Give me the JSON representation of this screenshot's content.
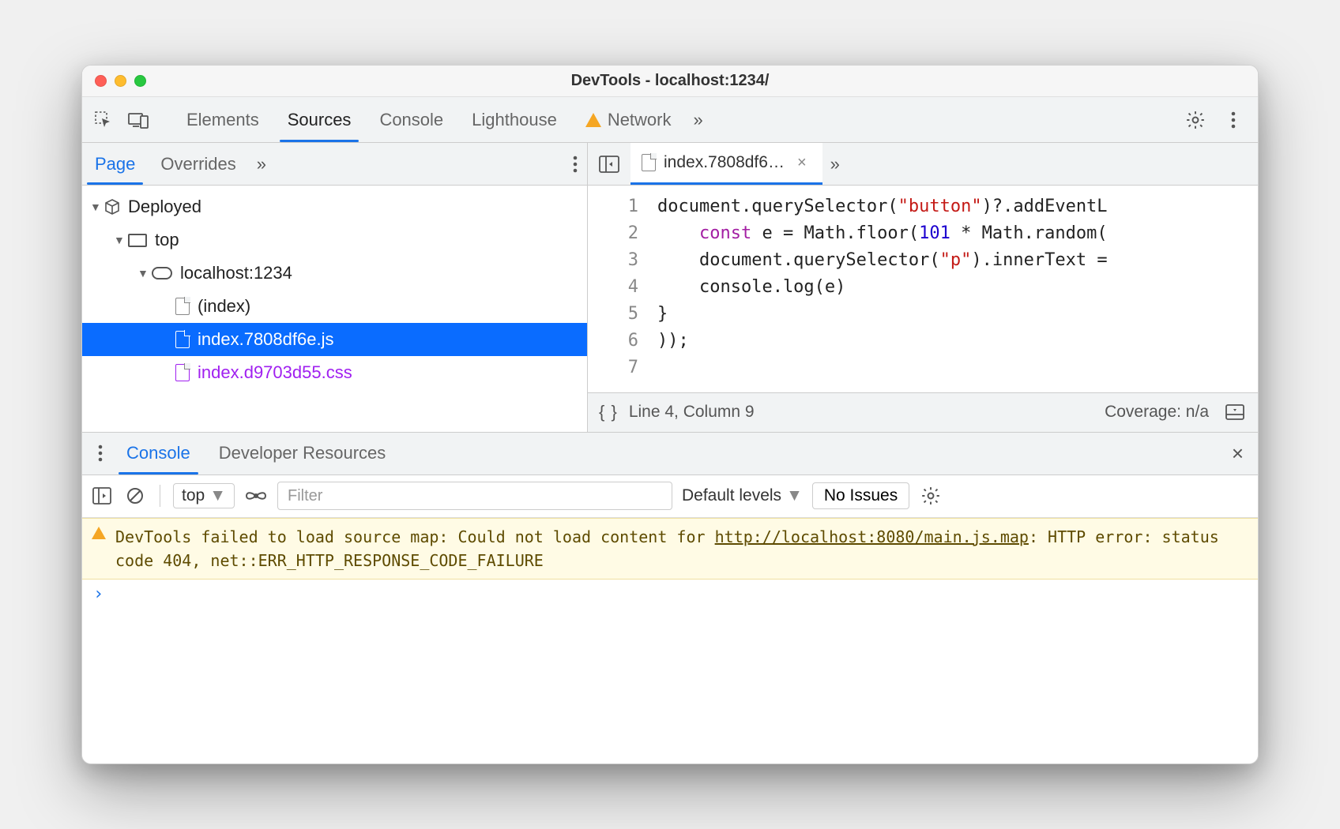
{
  "window": {
    "title": "DevTools - localhost:1234/"
  },
  "tabs": {
    "elements": "Elements",
    "sources": "Sources",
    "console": "Console",
    "lighthouse": "Lighthouse",
    "network": "Network"
  },
  "sources_subtabs": {
    "page": "Page",
    "overrides": "Overrides"
  },
  "editor_tab": {
    "filename": "index.7808df6…"
  },
  "tree": {
    "deployed": "Deployed",
    "top": "top",
    "host": "localhost:1234",
    "index": "(index)",
    "jsfile": "index.7808df6e.js",
    "cssfile": "index.d9703d55.css"
  },
  "code": {
    "l1a": "document.querySelector(",
    "l1b": "\"button\"",
    "l1c": ")?.addEventL",
    "l2a": "    ",
    "l2kw": "const",
    "l2b": " e = Math.floor(",
    "l2num": "101",
    "l2c": " * Math.random(",
    "l3a": "    document.querySelector(",
    "l3b": "\"p\"",
    "l3c": ").innerText =",
    "l4": "    console.log(e)",
    "l5": "}",
    "l6": "));",
    "l7": ""
  },
  "status": {
    "braces": "{ }",
    "pos": "Line 4, Column 9",
    "coverage": "Coverage: n/a"
  },
  "drawer": {
    "console": "Console",
    "devres": "Developer Resources"
  },
  "console_tb": {
    "context": "top",
    "filter_placeholder": "Filter",
    "levels": "Default levels",
    "issues": "No Issues"
  },
  "console_msg": {
    "pre": "DevTools failed to load source map: Could not load content for ",
    "url": "http://localhost:8080/main.js.map",
    "post": ": HTTP error: status code 404, net::ERR_HTTP_RESPONSE_CODE_FAILURE"
  },
  "prompt": "›"
}
